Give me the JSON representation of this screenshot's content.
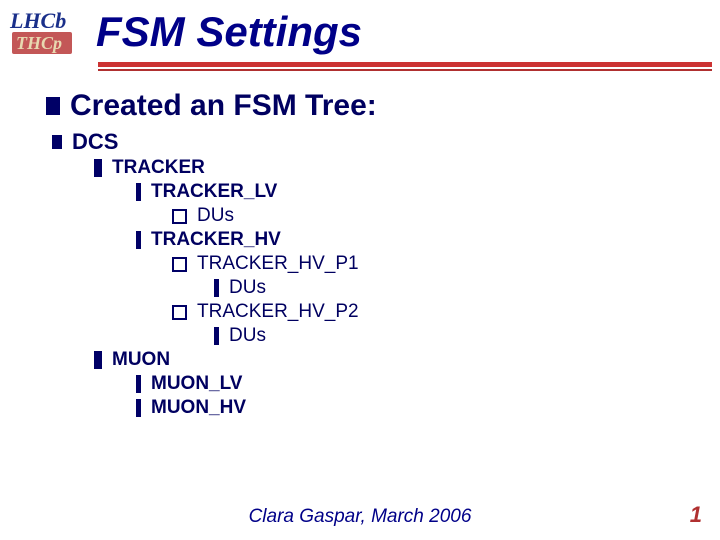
{
  "logo": {
    "top_text": "LHCb",
    "sub_text": "THCp"
  },
  "title": "FSM Settings",
  "heading": "Created an FSM Tree:",
  "tree": {
    "dcs": "DCS",
    "tracker": "TRACKER",
    "tracker_lv": "TRACKER_LV",
    "tracker_lv_dus": "DUs",
    "tracker_hv": "TRACKER_HV",
    "tracker_hv_p1": "TRACKER_HV_P1",
    "tracker_hv_p1_dus": "DUs",
    "tracker_hv_p2": "TRACKER_HV_P2",
    "tracker_hv_p2_dus": "DUs",
    "muon": "MUON",
    "muon_lv": "MUON_LV",
    "muon_hv": "MUON_HV"
  },
  "footer": "Clara Gaspar, March 2006",
  "page_number": "1"
}
